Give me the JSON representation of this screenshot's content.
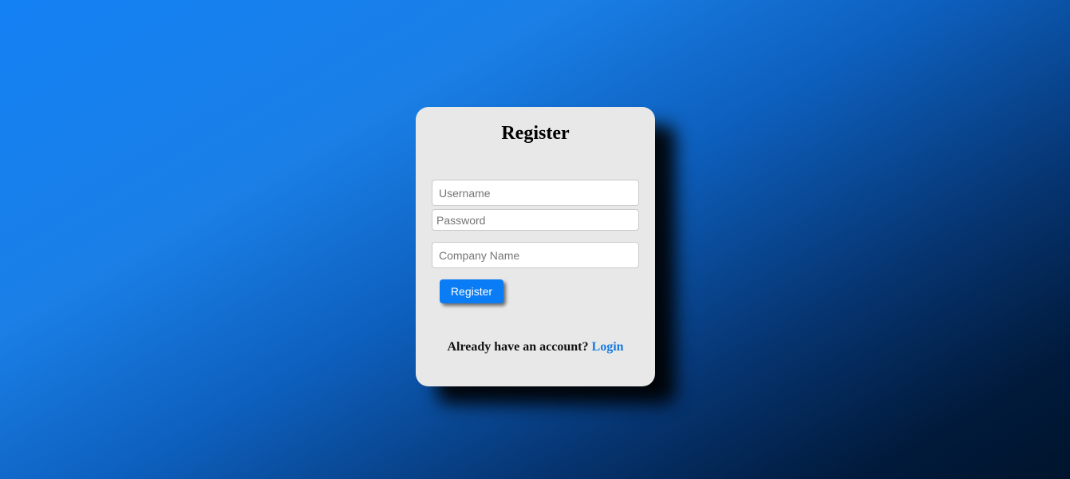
{
  "form": {
    "title": "Register",
    "username_placeholder": "Username",
    "password_placeholder": "Password",
    "company_placeholder": "Company Name",
    "submit_label": "Register",
    "footer_text": "Already have an account?",
    "login_link": "Login"
  },
  "colors": {
    "accent": "#0a7cf5",
    "card_background": "#e8e8e8",
    "link": "#1a7be0"
  }
}
